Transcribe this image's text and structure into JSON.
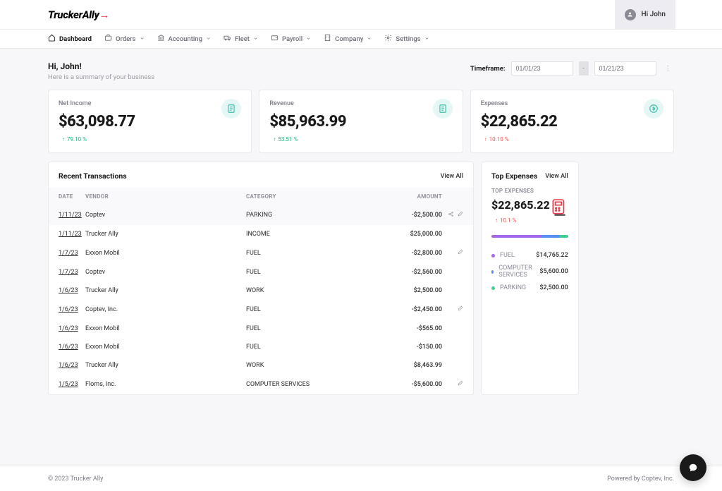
{
  "brand": {
    "name": "TruckerAlly"
  },
  "user": {
    "greeting_chip": "Hi John"
  },
  "nav": [
    {
      "label": "Dashboard",
      "icon": "home",
      "active": true,
      "dropdown": false
    },
    {
      "label": "Orders",
      "icon": "briefcase",
      "active": false,
      "dropdown": true
    },
    {
      "label": "Accounting",
      "icon": "bank",
      "active": false,
      "dropdown": true
    },
    {
      "label": "Fleet",
      "icon": "truck",
      "active": false,
      "dropdown": true
    },
    {
      "label": "Payroll",
      "icon": "wallet",
      "active": false,
      "dropdown": true
    },
    {
      "label": "Company",
      "icon": "building",
      "active": false,
      "dropdown": true
    },
    {
      "label": "Settings",
      "icon": "gear",
      "active": false,
      "dropdown": true
    }
  ],
  "greeting": {
    "title": "Hi, John!",
    "subtitle": "Here is a summary of your business"
  },
  "timeframe": {
    "label": "Timeframe:",
    "from": "01/01/23",
    "to": "01/21/23"
  },
  "cards": {
    "net_income": {
      "title": "Net Income",
      "value": "$63,098.77",
      "delta": "79.10 %",
      "direction": "up"
    },
    "revenue": {
      "title": "Revenue",
      "value": "$85,963.99",
      "delta": "53.51 %",
      "direction": "up"
    },
    "expenses": {
      "title": "Expenses",
      "value": "$22,865.22",
      "delta": "10.10 %",
      "direction": "down"
    }
  },
  "transactions": {
    "title": "Recent Transactions",
    "view_all": "View All",
    "columns": {
      "date": "DATE",
      "vendor": "VENDOR",
      "category": "CATEGORY",
      "amount": "AMOUNT"
    },
    "rows": [
      {
        "date": "1/11/23",
        "vendor": "Coptev",
        "category": "PARKING",
        "amount": "-$2,500.00",
        "icons": [
          "split",
          "edit"
        ]
      },
      {
        "date": "1/11/23",
        "vendor": "Trucker Ally",
        "category": "INCOME",
        "amount": "$25,000.00",
        "icons": []
      },
      {
        "date": "1/7/23",
        "vendor": "Exxon Mobil",
        "category": "FUEL",
        "amount": "-$2,800.00",
        "icons": [
          "edit"
        ]
      },
      {
        "date": "1/7/23",
        "vendor": "Coptev",
        "category": "FUEL",
        "amount": "-$2,560.00",
        "icons": []
      },
      {
        "date": "1/6/23",
        "vendor": "Trucker Ally",
        "category": "WORK",
        "amount": "$2,500.00",
        "icons": []
      },
      {
        "date": "1/6/23",
        "vendor": "Coptev, Inc.",
        "category": "FUEL",
        "amount": "-$2,450.00",
        "icons": [
          "edit"
        ]
      },
      {
        "date": "1/6/23",
        "vendor": "Exxon Mobil",
        "category": "FUEL",
        "amount": "-$565.00",
        "icons": []
      },
      {
        "date": "1/6/23",
        "vendor": "Exxon Mobil",
        "category": "FUEL",
        "amount": "-$150.00",
        "icons": []
      },
      {
        "date": "1/6/23",
        "vendor": "Trucker Ally",
        "category": "WORK",
        "amount": "$8,463.99",
        "icons": []
      },
      {
        "date": "1/5/23",
        "vendor": "Floms, Inc.",
        "category": "COMPUTER SERVICES",
        "amount": "-$5,600.00",
        "icons": [
          "edit"
        ]
      }
    ]
  },
  "top_expenses": {
    "title": "Top Expenses",
    "view_all": "View All",
    "label": "TOP EXPENSES",
    "value": "$22,865.22",
    "delta": "10.1 %",
    "direction": "down",
    "colors": {
      "FUEL": "#a667e8",
      "COMPUTER SERVICES": "#5a8ff2",
      "PARKING": "#3fcf8e"
    },
    "items": [
      {
        "name": "FUEL",
        "amount": "$14,765.22",
        "weight": 64.6
      },
      {
        "name": "COMPUTER SERVICES",
        "amount": "$5,600.00",
        "weight": 24.5
      },
      {
        "name": "PARKING",
        "amount": "$2,500.00",
        "weight": 10.9
      }
    ]
  },
  "footer": {
    "left": "© 2023 Trucker Ally",
    "right": "Powered by Coptev, Inc."
  }
}
